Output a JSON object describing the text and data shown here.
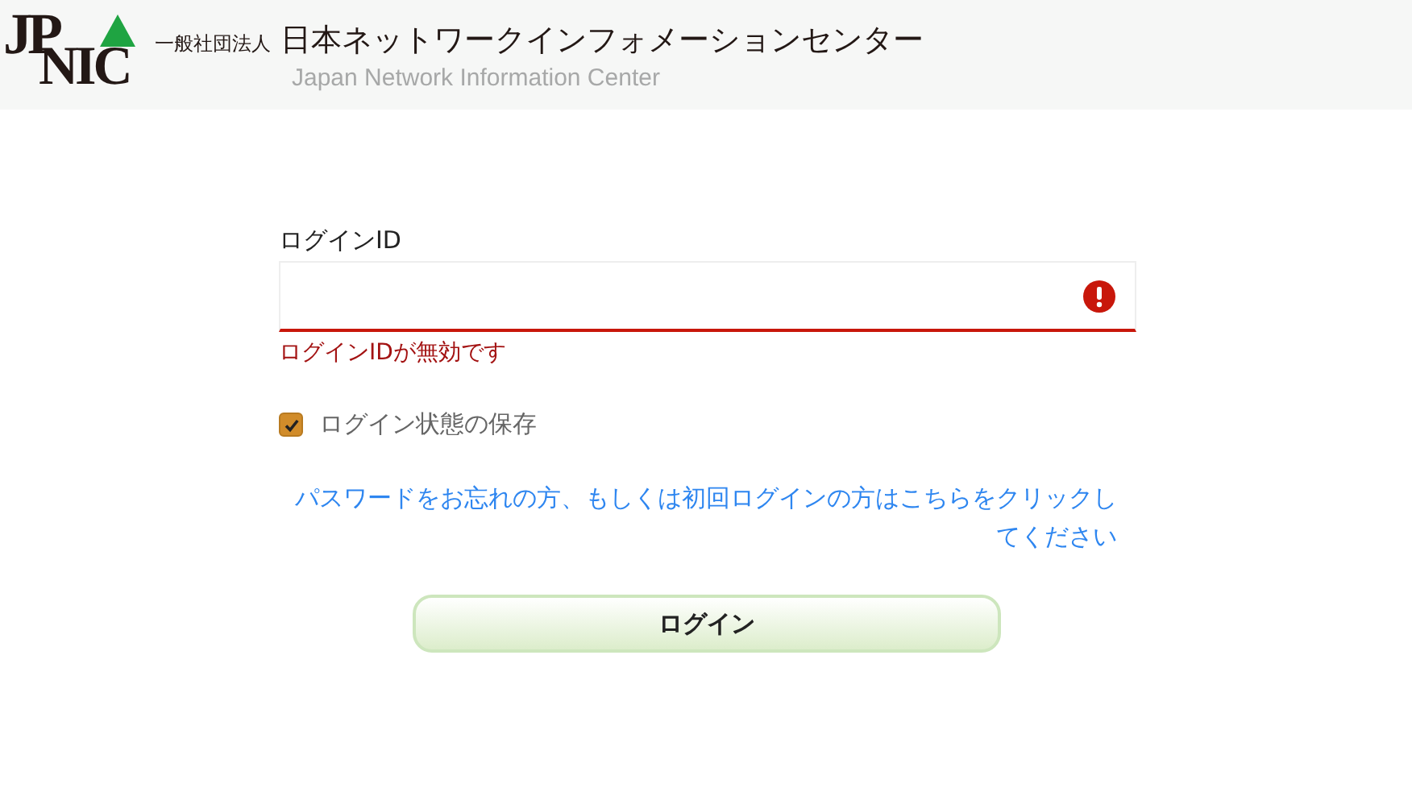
{
  "header": {
    "logo_top": "JP",
    "logo_bottom": "NIC",
    "org_type": "一般社団法人",
    "org_name": "日本ネットワークインフォメーションセンター",
    "org_name_en": "Japan Network Information Center"
  },
  "form": {
    "id_label": "ログインID",
    "id_invalid": true,
    "id_error": "ログインIDが無効です",
    "remember": {
      "label": "ログイン状態の保存",
      "checked": true
    },
    "forgot_link": "パスワードをお忘れの方、もしくは初回ログインの方はこちらをクリックしてください",
    "submit": "ログイン"
  }
}
